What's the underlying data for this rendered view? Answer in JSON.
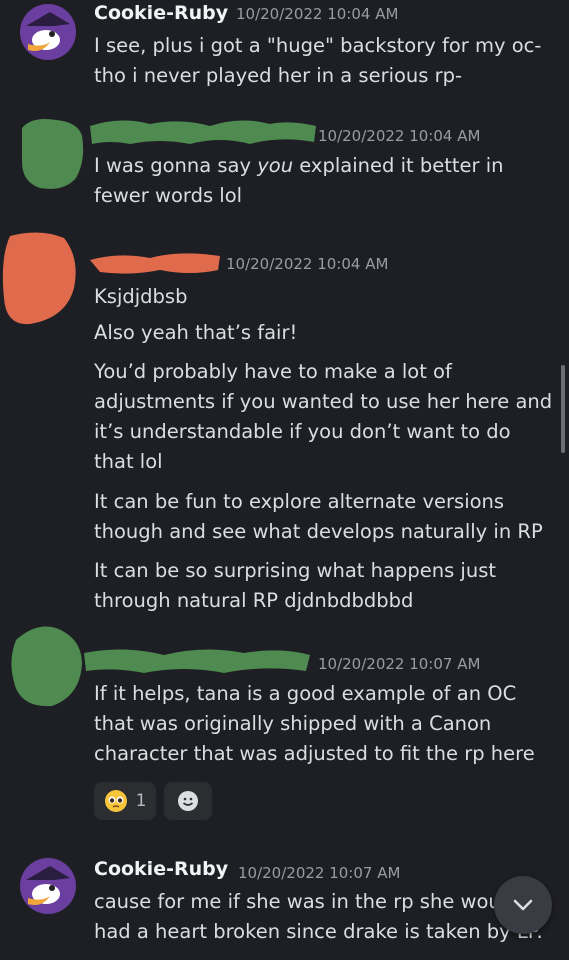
{
  "messages": [
    {
      "username": "Cookie-Ruby",
      "timestamp": "10/20/2022 10:04 AM",
      "lines": [
        "I see, plus i got a \"huge\" backstory for my oc-",
        "tho i never played her in a serious rp-"
      ]
    },
    {
      "timestamp": "10/20/2022 10:04 AM",
      "line1_pre": "I was gonna say ",
      "line1_em": "you",
      "line1_post": " explained it better in",
      "line2": "fewer words lol"
    },
    {
      "timestamp": "10/20/2022 10:04 AM",
      "paragraphs": [
        "Ksjdjdbsb",
        "Also yeah that’s fair!",
        "You’d probably have to make a lot of adjustments if you wanted to use her here and it’s understandable if you don’t want to do that lol",
        "It can be fun to explore alternate versions though and see what develops naturally in RP",
        "It can be so surprising what happens just through natural RP djdnbdbdbbd"
      ]
    },
    {
      "timestamp": "10/20/2022 10:07 AM",
      "text": "If it helps, tana is a good example of an OC that was originally shipped with a Canon character that was adjusted to fit the rp here",
      "reaction_count": "1"
    },
    {
      "username": "Cookie-Ruby",
      "timestamp": "10/20/2022 10:07 AM",
      "text": "cause for me if she was in the rp she would had a heart broken since drake is taken by LP."
    }
  ],
  "colors": {
    "background": "#1e1f24",
    "redact_green": "#4f8a50",
    "redact_red": "#e06a4c"
  },
  "icons": {
    "reaction_emoji": "pleading-face-emoji",
    "add_reaction": "smile-add-icon",
    "jump": "chevron-down-icon"
  }
}
